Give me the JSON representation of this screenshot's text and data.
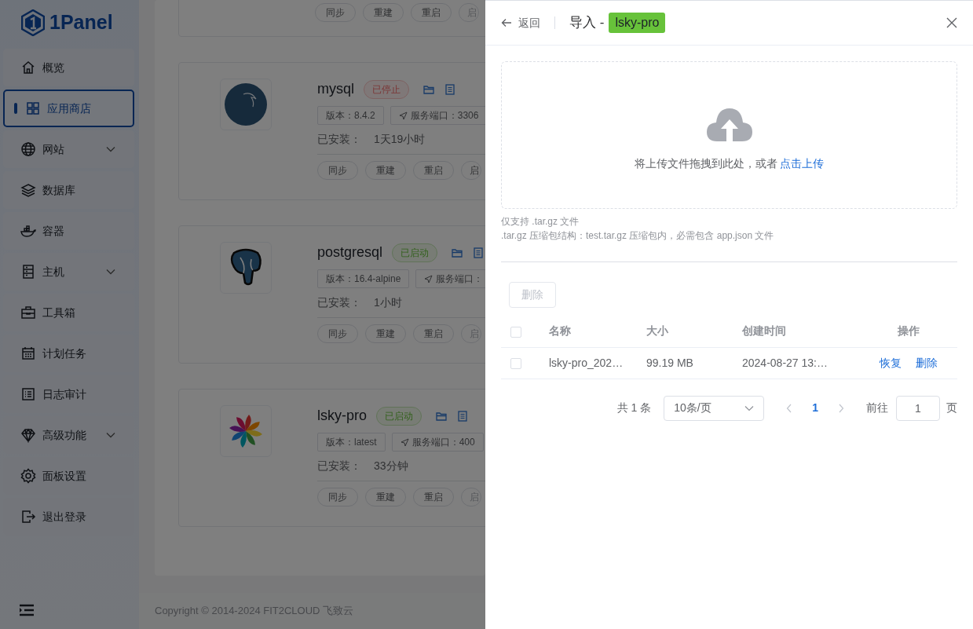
{
  "sidebar": {
    "logo": "1Panel",
    "items": [
      {
        "label": "概览",
        "selected": false,
        "expandable": false
      },
      {
        "label": "应用商店",
        "selected": true,
        "expandable": false
      },
      {
        "label": "网站",
        "selected": false,
        "expandable": true
      },
      {
        "label": "数据库",
        "selected": false,
        "expandable": false
      },
      {
        "label": "容器",
        "selected": false,
        "expandable": false
      },
      {
        "label": "主机",
        "selected": false,
        "expandable": true
      },
      {
        "label": "工具箱",
        "selected": false,
        "expandable": false
      },
      {
        "label": "计划任务",
        "selected": false,
        "expandable": false
      },
      {
        "label": "日志审计",
        "selected": false,
        "expandable": false
      },
      {
        "label": "高级功能",
        "selected": false,
        "expandable": true
      },
      {
        "label": "面板设置",
        "selected": false,
        "expandable": false
      },
      {
        "label": "退出登录",
        "selected": false,
        "expandable": false
      }
    ]
  },
  "apps": [
    {
      "kind": "partial",
      "actions": [
        {
          "label": "同步",
          "disabled": false
        },
        {
          "label": "重建",
          "disabled": false
        },
        {
          "label": "重启",
          "disabled": false
        },
        {
          "label": "启",
          "disabled": true
        }
      ]
    },
    {
      "kind": "full",
      "name": "mysql",
      "status": "已停止",
      "running": false,
      "version": "版本：8.4.2",
      "port": "服务端口：3306",
      "installed_label": "已安装：",
      "installed": "1天19小时",
      "actions": [
        {
          "label": "同步",
          "disabled": false
        },
        {
          "label": "重建",
          "disabled": false
        },
        {
          "label": "重启",
          "disabled": false
        },
        {
          "label": "启",
          "disabled": false
        }
      ]
    },
    {
      "kind": "full",
      "name": "postgresql",
      "status": "已启动",
      "running": true,
      "version": "版本：16.4-alpine",
      "port": "服务端口：",
      "installed_label": "已安装：",
      "installed": "1小时",
      "actions": [
        {
          "label": "同步",
          "disabled": false
        },
        {
          "label": "重建",
          "disabled": false
        },
        {
          "label": "重启",
          "disabled": false
        },
        {
          "label": "启",
          "disabled": true
        }
      ]
    },
    {
      "kind": "full",
      "name": "lsky-pro",
      "status": "已启动",
      "running": true,
      "version": "版本：latest",
      "port": "服务端口：400",
      "installed_label": "已安装：",
      "installed": "33分钟",
      "actions": [
        {
          "label": "同步",
          "disabled": false
        },
        {
          "label": "重建",
          "disabled": false
        },
        {
          "label": "重启",
          "disabled": false
        },
        {
          "label": "启",
          "disabled": true
        }
      ]
    }
  ],
  "footer": "Copyright © 2014-2024 FIT2CLOUD 飞致云",
  "drawer": {
    "back": "返回",
    "title": "导入 -",
    "tag": "lsky-pro",
    "upload": {
      "text": "将上传文件拖拽到此处，或者",
      "link": "点击上传"
    },
    "hints": [
      "仅支持 .tar.gz 文件",
      ".tar.gz 压缩包结构：test.tar.gz 压缩包内，必需包含 app.json 文件"
    ],
    "delete_button": {
      "label": "删除",
      "disabled": true
    },
    "table": {
      "all_checked": false,
      "columns": [
        "名称",
        "大小",
        "创建时间",
        "操作"
      ],
      "rows": [
        {
          "checked": false,
          "name": "lsky-pro_202…",
          "size": "99.19 MB",
          "created": "2024-08-27 13:…",
          "actions": [
            "恢复",
            "删除"
          ]
        }
      ]
    },
    "pagination": {
      "total": "共 1 条",
      "page_size": "10条/页",
      "pages": [
        {
          "label": "1",
          "selected": true
        }
      ],
      "goto_label": "前往",
      "goto_value": "1",
      "page_unit": "页"
    }
  }
}
